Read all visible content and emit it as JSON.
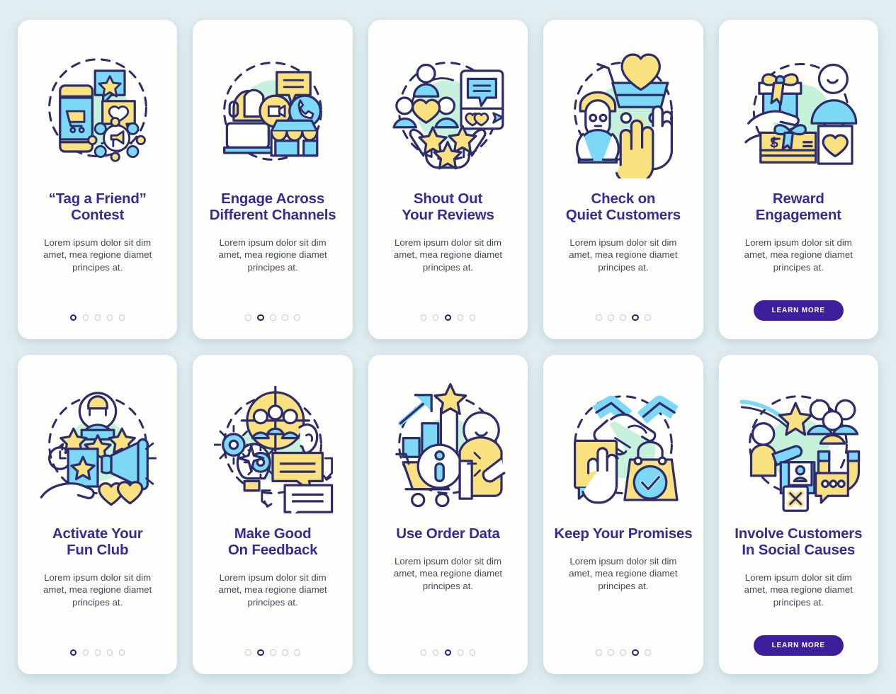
{
  "page": {
    "background_color": "#e1eef1",
    "card_background_color": "#fdfdfb",
    "title_color": "#3a2a94",
    "body_color": "#404b5b",
    "button_color": "#3d1f9c",
    "accent_dot_active_color": "#2c1d7a",
    "accent_dot_inactive_color": "#c9c9d4",
    "illustration_palette": [
      "#2e2d6b",
      "#7cd8f5",
      "#fae17f",
      "#c6f1da",
      "#ffffff"
    ]
  },
  "cards": [
    {
      "id": "tag-a-friend-contest",
      "title": "“Tag a Friend”\nContest",
      "title_lines": [
        "“Tag a Friend”",
        "Contest"
      ],
      "description": "Lorem ipsum dolor sit dim amet, mea regione diamet principes at.",
      "footer_type": "dots",
      "dots_total": 5,
      "dots_active_index": 1,
      "icon": "phone-cart-megaphone-network-icon"
    },
    {
      "id": "engage-across-different-channels",
      "title": "Engage Across\nDifferent Channels",
      "title_lines": [
        "Engage Across",
        "Different Channels"
      ],
      "description": "Lorem ipsum dolor sit dim amet, mea regione diamet principes at.",
      "footer_type": "dots",
      "dots_total": 5,
      "dots_active_index": 2,
      "icon": "support-agent-channels-store-icon"
    },
    {
      "id": "shout-out-your-reviews",
      "title": "Shout Out\nYour Reviews",
      "title_lines": [
        "Shout Out",
        "Your Reviews"
      ],
      "description": "Lorem ipsum dolor sit dim amet, mea regione diamet principes at.",
      "footer_type": "dots",
      "dots_total": 5,
      "dots_active_index": 3,
      "icon": "community-reviews-stars-icon"
    },
    {
      "id": "check-on-quiet-customers",
      "title": "Check on\nQuiet Customers",
      "title_lines": [
        "Check on",
        "Quiet Customers"
      ],
      "description": "Lorem ipsum dolor sit dim amet, mea regione diamet principes at.",
      "footer_type": "dots",
      "dots_total": 5,
      "dots_active_index": 4,
      "icon": "quiet-customer-cart-highfive-icon"
    },
    {
      "id": "reward-engagement",
      "title": "Reward\nEngagement",
      "title_lines": [
        "Reward",
        "Engagement"
      ],
      "description": "Lorem ipsum dolor sit dim amet, mea regione diamet principes at.",
      "footer_type": "button",
      "button_label": "LEARN MORE",
      "icon": "gift-giftcard-shopper-icon"
    },
    {
      "id": "activate-your-fun-club",
      "title": "Activate Your\nFun Club",
      "title_lines": [
        "Activate Your",
        "Fun Club"
      ],
      "description": "Lorem ipsum dolor sit dim amet, mea regione diamet principes at.",
      "footer_type": "dots",
      "dots_total": 5,
      "dots_active_index": 1,
      "icon": "fan-stars-megaphone-hearts-icon"
    },
    {
      "id": "make-good-on-feedback",
      "title": "Make Good\nOn Feedback",
      "title_lines": [
        "Make Good",
        "On Feedback"
      ],
      "description": "Lorem ipsum dolor sit dim amet, mea regione diamet principes at.",
      "footer_type": "dots",
      "dots_total": 5,
      "dots_active_index": 2,
      "icon": "target-audience-listen-reply-icon"
    },
    {
      "id": "use-order-data",
      "title": "Use Order Data",
      "title_lines": [
        "Use Order Data"
      ],
      "description": "Lorem ipsum dolor sit dim amet, mea regione diamet principes at.",
      "footer_type": "dots",
      "dots_total": 5,
      "dots_active_index": 3,
      "icon": "growth-chart-info-cart-icon"
    },
    {
      "id": "keep-your-promises",
      "title": "Keep Your Promises",
      "title_lines": [
        "Keep Your Promises"
      ],
      "description": "Lorem ipsum dolor sit dim amet, mea regione diamet principes at.",
      "footer_type": "dots",
      "dots_total": 5,
      "dots_active_index": 4,
      "icon": "handshake-oath-verified-bag-icon"
    },
    {
      "id": "involve-customers-in-social-causes",
      "title": "Involve Customers\nIn Social Causes",
      "title_lines": [
        "Involve Customers",
        "In Social Causes"
      ],
      "description": "Lorem ipsum dolor sit dim amet, mea regione diamet principes at.",
      "footer_type": "button",
      "button_label": "LEARN MORE",
      "icon": "social-causes-magnet-community-icon"
    }
  ]
}
